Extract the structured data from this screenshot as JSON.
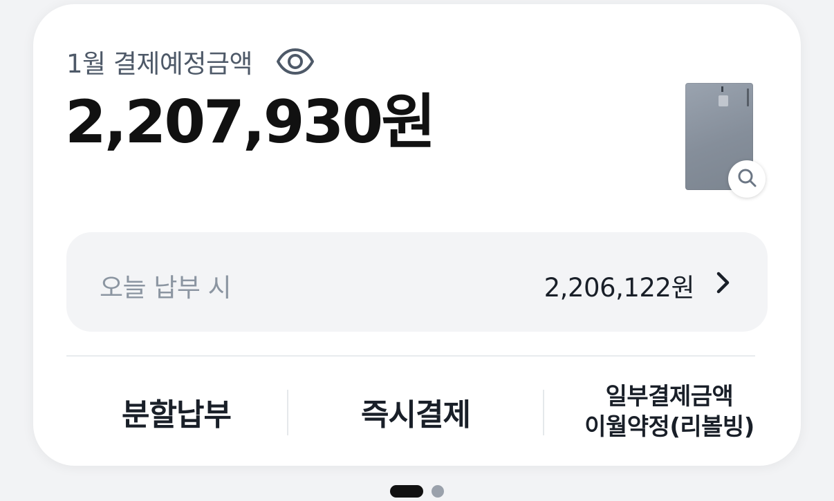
{
  "summary": {
    "title": "1월 결제예정금액",
    "amount": "2,207,930원",
    "visibility_icon": "eye-icon",
    "card_zoom_icon": "search-icon"
  },
  "today_payment": {
    "label": "오늘 납부 시",
    "value": "2,206,122원",
    "icon": "chevron-right-icon"
  },
  "actions": {
    "installment": "분할납부",
    "instant_payment": "즉시결제",
    "revolving_line1": "일부결제금액",
    "revolving_line2": "이월약정(리볼빙)"
  },
  "pager": {
    "total_pages": 2,
    "current_page": 1
  },
  "colors": {
    "background": "#f2f3f5",
    "card": "#ffffff",
    "primary_text": "#191f28",
    "secondary_text": "#4e5968",
    "muted_text": "#8b95a1",
    "today_box": "#f3f4f6"
  }
}
